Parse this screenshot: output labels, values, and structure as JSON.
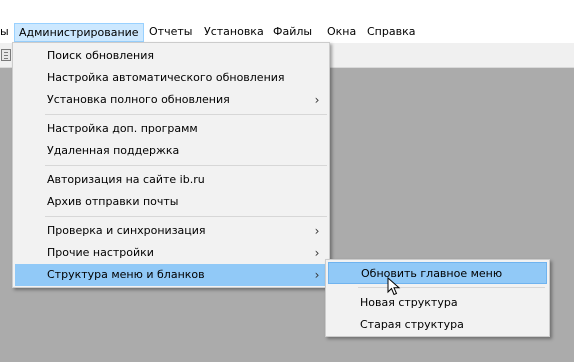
{
  "menubar": {
    "items": [
      {
        "label": "ы"
      },
      {
        "label": "Администрирование"
      },
      {
        "label": "Отчеты"
      },
      {
        "label": "Установка"
      },
      {
        "label": "Файлы"
      },
      {
        "label": "Окна"
      },
      {
        "label": "Справка"
      }
    ]
  },
  "admin_menu": {
    "items": [
      {
        "label": "Поиск обновления"
      },
      {
        "label": "Настройка автоматического обновления"
      },
      {
        "label": "Установка полного обновления",
        "arrow": "›"
      },
      {
        "label": "Настройка доп. программ"
      },
      {
        "label": "Удаленная поддержка"
      },
      {
        "label": "Авторизация на сайте ib.ru"
      },
      {
        "label": "Архив отправки почты"
      },
      {
        "label": "Проверка и синхронизация",
        "arrow": "›"
      },
      {
        "label": "Прочие настройки",
        "arrow": "›"
      },
      {
        "label": "Структура меню и бланков",
        "arrow": "›"
      }
    ]
  },
  "submenu": {
    "items": [
      {
        "label": "Обновить главное меню"
      },
      {
        "label": "Новая структура"
      },
      {
        "label": "Старая структура"
      }
    ]
  },
  "colors": {
    "highlight": "#91c9f7",
    "menubar_active": "#cce8ff",
    "workspace": "#ababab",
    "menu_bg": "#f2f2f2"
  }
}
